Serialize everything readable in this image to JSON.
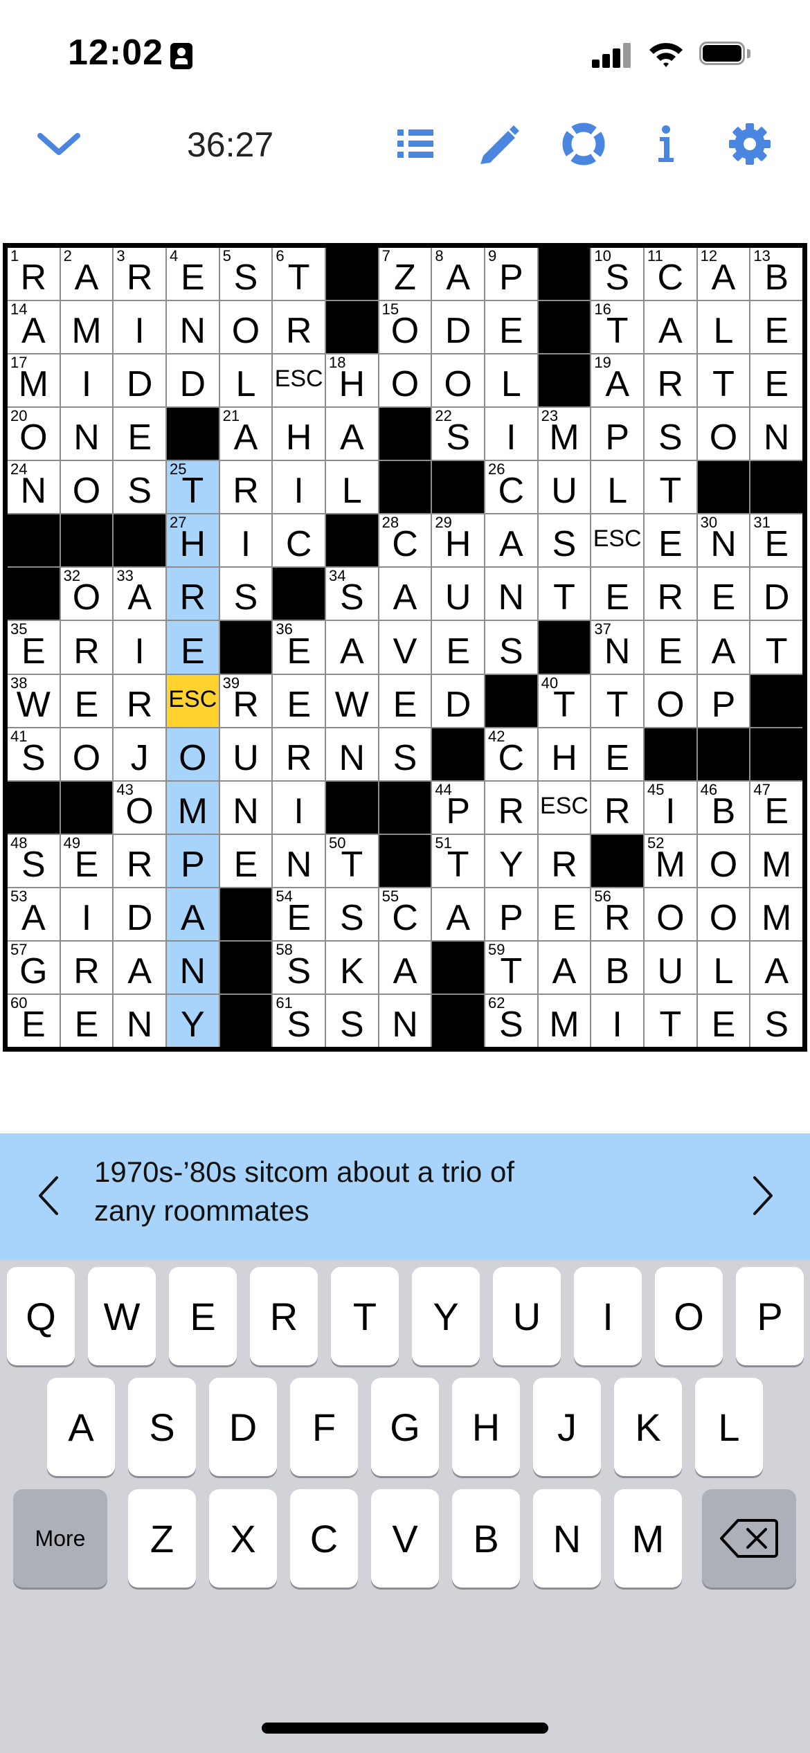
{
  "status": {
    "time": "12:02"
  },
  "toolbar": {
    "timer": "36:27",
    "icons": [
      "chevron-down-icon",
      "list-icon",
      "pencil-icon",
      "lifebuoy-icon",
      "info-icon",
      "gear-icon"
    ],
    "accent": "#4a86e0"
  },
  "grid": {
    "rows": [
      [
        {
          "n": "1",
          "l": "R"
        },
        {
          "n": "2",
          "l": "A"
        },
        {
          "n": "3",
          "l": "R"
        },
        {
          "n": "4",
          "l": "E"
        },
        {
          "n": "5",
          "l": "S"
        },
        {
          "n": "6",
          "l": "T"
        },
        {
          "b": true
        },
        {
          "n": "7",
          "l": "Z"
        },
        {
          "n": "8",
          "l": "A"
        },
        {
          "n": "9",
          "l": "P"
        },
        {
          "b": true
        },
        {
          "n": "10",
          "l": "S"
        },
        {
          "n": "11",
          "l": "C"
        },
        {
          "n": "12",
          "l": "A"
        },
        {
          "n": "13",
          "l": "B"
        }
      ],
      [
        {
          "n": "14",
          "l": "A"
        },
        {
          "l": "M"
        },
        {
          "l": "I"
        },
        {
          "l": "N"
        },
        {
          "l": "O"
        },
        {
          "l": "R"
        },
        {
          "b": true
        },
        {
          "n": "15",
          "l": "O"
        },
        {
          "l": "D"
        },
        {
          "l": "E"
        },
        {
          "b": true
        },
        {
          "n": "16",
          "l": "T"
        },
        {
          "l": "A"
        },
        {
          "l": "L"
        },
        {
          "l": "E"
        }
      ],
      [
        {
          "n": "17",
          "l": "M"
        },
        {
          "l": "I"
        },
        {
          "l": "D"
        },
        {
          "l": "D"
        },
        {
          "l": "L"
        },
        {
          "l": "ESC"
        },
        {
          "n": "18",
          "l": "H"
        },
        {
          "l": "O"
        },
        {
          "l": "O"
        },
        {
          "l": "L"
        },
        {
          "b": true
        },
        {
          "n": "19",
          "l": "A"
        },
        {
          "l": "R"
        },
        {
          "l": "T"
        },
        {
          "l": "E"
        }
      ],
      [
        {
          "n": "20",
          "l": "O"
        },
        {
          "l": "N"
        },
        {
          "l": "E"
        },
        {
          "b": true
        },
        {
          "n": "21",
          "l": "A"
        },
        {
          "l": "H"
        },
        {
          "l": "A"
        },
        {
          "b": true
        },
        {
          "n": "22",
          "l": "S"
        },
        {
          "l": "I"
        },
        {
          "n": "23",
          "l": "M"
        },
        {
          "l": "P"
        },
        {
          "l": "S"
        },
        {
          "l": "O"
        },
        {
          "l": "N"
        }
      ],
      [
        {
          "n": "24",
          "l": "N"
        },
        {
          "l": "O"
        },
        {
          "l": "S"
        },
        {
          "n": "25",
          "l": "T",
          "h": true
        },
        {
          "l": "R"
        },
        {
          "l": "I"
        },
        {
          "l": "L"
        },
        {
          "b": true
        },
        {
          "b": true
        },
        {
          "n": "26",
          "l": "C"
        },
        {
          "l": "U"
        },
        {
          "l": "L"
        },
        {
          "l": "T"
        },
        {
          "b": true
        },
        {
          "b": true
        }
      ],
      [
        {
          "b": true
        },
        {
          "b": true
        },
        {
          "b": true
        },
        {
          "n": "27",
          "l": "H",
          "h": true
        },
        {
          "l": "I"
        },
        {
          "l": "C"
        },
        {
          "b": true
        },
        {
          "n": "28",
          "l": "C"
        },
        {
          "n": "29",
          "l": "H"
        },
        {
          "l": "A"
        },
        {
          "l": "S"
        },
        {
          "l": "ESC"
        },
        {
          "l": "E"
        },
        {
          "n": "30",
          "l": "N"
        },
        {
          "n": "31",
          "l": "E"
        }
      ],
      [
        {
          "b": true
        },
        {
          "n": "32",
          "l": "O"
        },
        {
          "n": "33",
          "l": "A"
        },
        {
          "l": "R",
          "h": true
        },
        {
          "l": "S"
        },
        {
          "b": true
        },
        {
          "n": "34",
          "l": "S"
        },
        {
          "l": "A"
        },
        {
          "l": "U"
        },
        {
          "l": "N"
        },
        {
          "l": "T"
        },
        {
          "l": "E"
        },
        {
          "l": "R"
        },
        {
          "l": "E"
        },
        {
          "l": "D"
        }
      ],
      [
        {
          "n": "35",
          "l": "E"
        },
        {
          "l": "R"
        },
        {
          "l": "I"
        },
        {
          "l": "E",
          "h": true
        },
        {
          "b": true
        },
        {
          "n": "36",
          "l": "E"
        },
        {
          "l": "A"
        },
        {
          "l": "V"
        },
        {
          "l": "E"
        },
        {
          "l": "S"
        },
        {
          "b": true
        },
        {
          "n": "37",
          "l": "N"
        },
        {
          "l": "E"
        },
        {
          "l": "A"
        },
        {
          "l": "T"
        }
      ],
      [
        {
          "n": "38",
          "l": "W"
        },
        {
          "l": "E"
        },
        {
          "l": "R"
        },
        {
          "l": "ESC",
          "s": true
        },
        {
          "n": "39",
          "l": "R"
        },
        {
          "l": "E"
        },
        {
          "l": "W"
        },
        {
          "l": "E"
        },
        {
          "l": "D"
        },
        {
          "b": true
        },
        {
          "n": "40",
          "l": "T"
        },
        {
          "l": "T"
        },
        {
          "l": "O"
        },
        {
          "l": "P"
        },
        {
          "b": true
        }
      ],
      [
        {
          "n": "41",
          "l": "S"
        },
        {
          "l": "O"
        },
        {
          "l": "J"
        },
        {
          "l": "O",
          "h": true
        },
        {
          "l": "U"
        },
        {
          "l": "R"
        },
        {
          "l": "N"
        },
        {
          "l": "S"
        },
        {
          "b": true
        },
        {
          "n": "42",
          "l": "C"
        },
        {
          "l": "H"
        },
        {
          "l": "E"
        },
        {
          "b": true
        },
        {
          "b": true
        },
        {
          "b": true
        }
      ],
      [
        {
          "b": true
        },
        {
          "b": true
        },
        {
          "n": "43",
          "l": "O"
        },
        {
          "l": "M",
          "h": true
        },
        {
          "l": "N"
        },
        {
          "l": "I"
        },
        {
          "b": true
        },
        {
          "b": true
        },
        {
          "n": "44",
          "l": "P"
        },
        {
          "l": "R"
        },
        {
          "l": "ESC"
        },
        {
          "l": "R"
        },
        {
          "n": "45",
          "l": "I"
        },
        {
          "n": "46",
          "l": "B"
        },
        {
          "n": "47",
          "l": "E"
        }
      ],
      [
        {
          "n": "48",
          "l": "S"
        },
        {
          "n": "49",
          "l": "E"
        },
        {
          "l": "R"
        },
        {
          "l": "P",
          "h": true
        },
        {
          "l": "E"
        },
        {
          "l": "N"
        },
        {
          "n": "50",
          "l": "T"
        },
        {
          "b": true
        },
        {
          "n": "51",
          "l": "T"
        },
        {
          "l": "Y"
        },
        {
          "l": "R"
        },
        {
          "b": true
        },
        {
          "n": "52",
          "l": "M"
        },
        {
          "l": "O"
        },
        {
          "l": "M"
        }
      ],
      [
        {
          "n": "53",
          "l": "A"
        },
        {
          "l": "I"
        },
        {
          "l": "D"
        },
        {
          "l": "A",
          "h": true
        },
        {
          "b": true
        },
        {
          "n": "54",
          "l": "E"
        },
        {
          "l": "S"
        },
        {
          "n": "55",
          "l": "C"
        },
        {
          "l": "A"
        },
        {
          "l": "P"
        },
        {
          "l": "E"
        },
        {
          "n": "56",
          "l": "R"
        },
        {
          "l": "O"
        },
        {
          "l": "O"
        },
        {
          "l": "M"
        }
      ],
      [
        {
          "n": "57",
          "l": "G"
        },
        {
          "l": "R"
        },
        {
          "l": "A"
        },
        {
          "l": "N",
          "h": true
        },
        {
          "b": true
        },
        {
          "n": "58",
          "l": "S"
        },
        {
          "l": "K"
        },
        {
          "l": "A"
        },
        {
          "b": true
        },
        {
          "n": "59",
          "l": "T"
        },
        {
          "l": "A"
        },
        {
          "l": "B"
        },
        {
          "l": "U"
        },
        {
          "l": "L"
        },
        {
          "l": "A"
        }
      ],
      [
        {
          "n": "60",
          "l": "E"
        },
        {
          "l": "E"
        },
        {
          "l": "N"
        },
        {
          "l": "Y",
          "h": true
        },
        {
          "b": true
        },
        {
          "n": "61",
          "l": "S"
        },
        {
          "l": "S"
        },
        {
          "l": "N"
        },
        {
          "b": true
        },
        {
          "n": "62",
          "l": "S"
        },
        {
          "l": "M"
        },
        {
          "l": "I"
        },
        {
          "l": "T"
        },
        {
          "l": "E"
        },
        {
          "l": "S"
        }
      ]
    ],
    "highlight_color": "#a8d4fb",
    "selected_color": "#fed330"
  },
  "clue": {
    "line1": "1970s-’80s sitcom about a trio of",
    "line2": "zany roommates",
    "prev_icon": "chevron-left-icon",
    "next_icon": "chevron-right-icon"
  },
  "keyboard": {
    "row1": [
      "Q",
      "W",
      "E",
      "R",
      "T",
      "Y",
      "U",
      "I",
      "O",
      "P"
    ],
    "row2": [
      "A",
      "S",
      "D",
      "F",
      "G",
      "H",
      "J",
      "K",
      "L"
    ],
    "row3": [
      "Z",
      "X",
      "C",
      "V",
      "B",
      "N",
      "M"
    ],
    "more_label": "More",
    "backspace_icon": "backspace-icon"
  }
}
